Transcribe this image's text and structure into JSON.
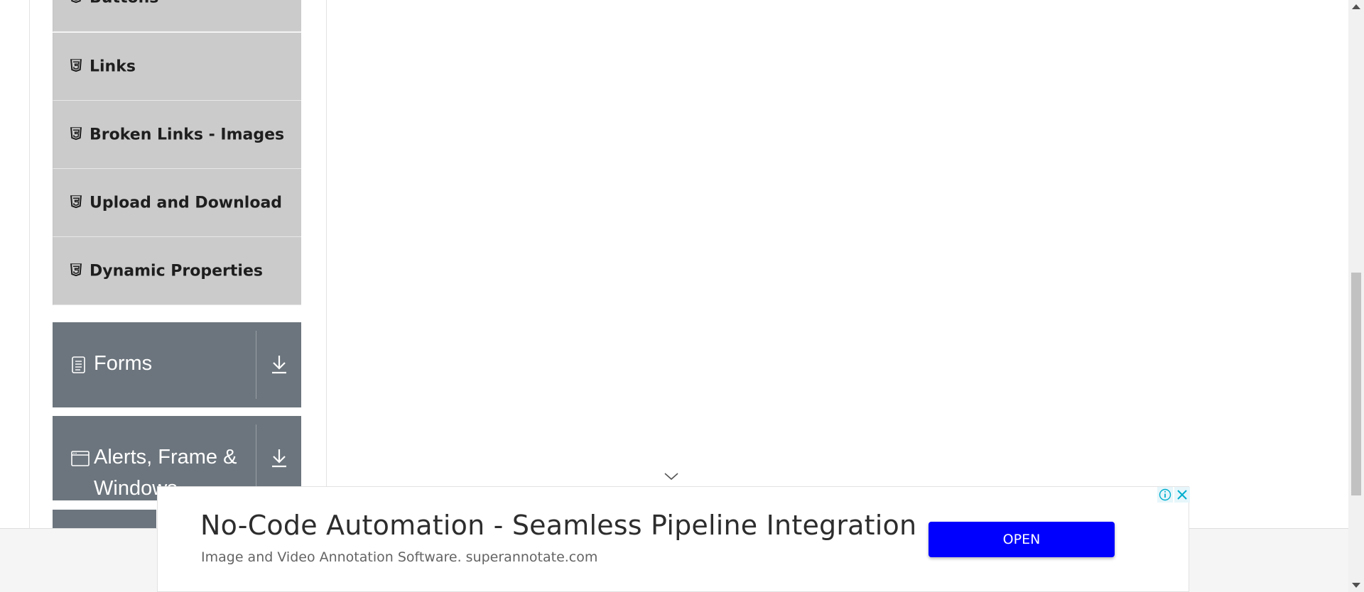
{
  "sidebar": {
    "sub_items": [
      {
        "label": "Buttons",
        "icon": "html5-icon"
      },
      {
        "label": "Links",
        "icon": "html5-icon"
      },
      {
        "label": "Broken Links - Images",
        "icon": "html5-icon"
      },
      {
        "label": "Upload and Download",
        "icon": "html5-icon"
      },
      {
        "label": "Dynamic Properties",
        "icon": "html5-icon"
      }
    ],
    "groups": [
      {
        "label": "Forms",
        "icon": "document-icon",
        "toggle_icon": "download-arrow-icon"
      },
      {
        "label": "Alerts, Frame & Windows",
        "icon": "window-icon",
        "toggle_icon": "download-arrow-icon"
      }
    ]
  },
  "ad": {
    "title": "No-Code Automation - Seamless Pipeline Integration",
    "subtitle": "Image and Video Annotation Software. superannotate.com",
    "button_label": "OPEN",
    "button_color": "#0000ff"
  },
  "colors": {
    "submenu_bg": "#cbcbcb",
    "group_bg": "#6c757d",
    "bottom_bar": "#f5f5f5"
  }
}
